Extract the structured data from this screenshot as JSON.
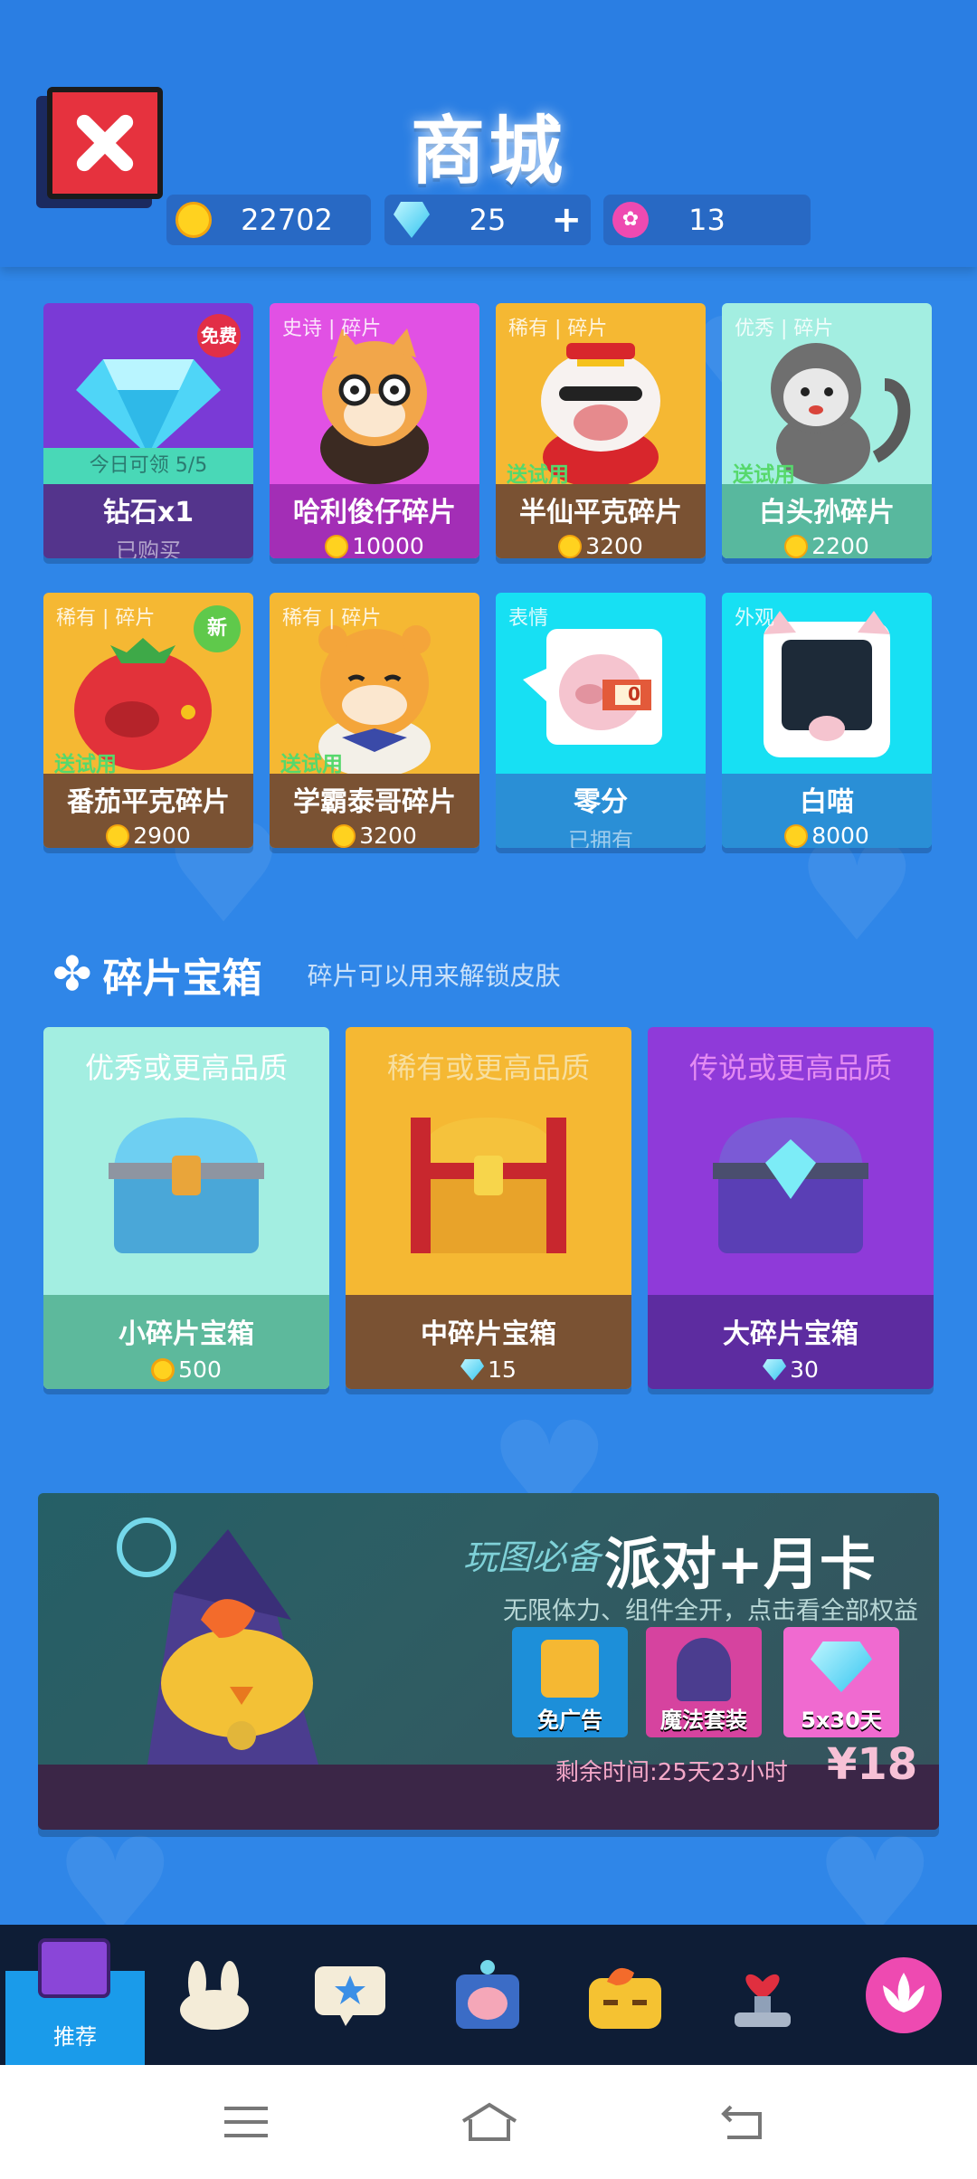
{
  "header": {
    "title": "商城",
    "coins": "22702",
    "gems": "25",
    "gem_plus": "+",
    "lotus": "13"
  },
  "items": [
    {
      "name": "钻石x1",
      "sub": "已购买",
      "daily": "今日可领 5/5",
      "badge": "免费",
      "icon": "diamond-icon"
    },
    {
      "name": "哈利俊仔碎片",
      "price": "10000",
      "tag": "史诗 | 碎片",
      "icon": "shiba-dog-icon"
    },
    {
      "name": "半仙平克碎片",
      "price": "3200",
      "tag": "稀有 | 碎片",
      "trial": "送试用",
      "icon": "pig-icon"
    },
    {
      "name": "白头孙碎片",
      "price": "2200",
      "tag": "优秀 | 碎片",
      "trial": "送试用",
      "icon": "monkey-icon"
    },
    {
      "name": "番茄平克碎片",
      "price": "2900",
      "tag": "稀有 | 碎片",
      "trial": "送试用",
      "badge": "新",
      "icon": "tomato-pig-icon"
    },
    {
      "name": "学霸泰哥碎片",
      "price": "3200",
      "tag": "稀有 | 碎片",
      "trial": "送试用",
      "icon": "tiger-icon"
    },
    {
      "name": "零分",
      "sub": "已拥有",
      "tag": "表情",
      "score": "0",
      "icon": "pig-sticker-icon"
    },
    {
      "name": "白喵",
      "price": "8000",
      "tag": "外观",
      "icon": "cat-icon"
    }
  ],
  "chest_section": {
    "title": "碎片宝箱",
    "desc": "碎片可以用来解锁皮肤"
  },
  "chests": [
    {
      "quality": "优秀或更高品质",
      "name": "小碎片宝箱",
      "price": "500",
      "currency": "coin"
    },
    {
      "quality": "稀有或更高品质",
      "name": "中碎片宝箱",
      "price": "15",
      "currency": "gem"
    },
    {
      "quality": "传说或更高品质",
      "name": "大碎片宝箱",
      "price": "30",
      "currency": "gem"
    }
  ],
  "banner": {
    "script": "玩图必备",
    "headline": "派对+月卡",
    "desc": "无限体力、组件全开，点击看全部权益",
    "perks": [
      "免广告",
      "魔法套装",
      "5x30天"
    ],
    "time": "剩余时间:25天23小时",
    "price": "¥18"
  },
  "nav": {
    "items": [
      "推荐"
    ]
  },
  "colors": {
    "background": "#2f86e8",
    "purple": "#7a3ad6",
    "magenta": "#e151e4",
    "yellow": "#f5b833",
    "mint": "#a3eee1",
    "cyan": "#17e0f3",
    "brown": "#7a5233",
    "nav": "#0e1d36",
    "active_tab": "#1a9bea"
  }
}
